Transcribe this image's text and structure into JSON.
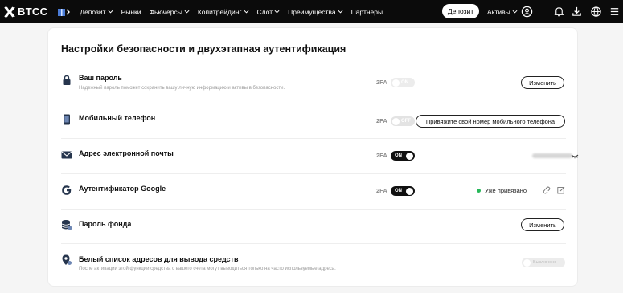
{
  "nav": {
    "logo_text": "BTCC",
    "items": [
      {
        "label": "Депозит",
        "has_caret": true
      },
      {
        "label": "Рынки",
        "has_caret": false
      },
      {
        "label": "Фьючерсы",
        "has_caret": true
      },
      {
        "label": "Копитрейдинг",
        "has_caret": true
      },
      {
        "label": "Слот",
        "has_caret": true
      },
      {
        "label": "Преимущества",
        "has_caret": true
      },
      {
        "label": "Партнеры",
        "has_caret": false
      }
    ],
    "deposit_button": "Депозит",
    "assets_label": "Активы",
    "icons": [
      "user-icon",
      "bell-icon",
      "download-icon",
      "globe-icon",
      "menu-icon"
    ]
  },
  "page": {
    "title": "Настройки безопасности и двухэтапная аутентификация"
  },
  "rows": [
    {
      "title": "Ваш пароль",
      "desc": "Надежный пароль поможет сохранить вашу личную информацию и активы в безопасности.",
      "twofa": "2FA",
      "toggle": {
        "state": "off",
        "label": "ON"
      },
      "action": "Изменить",
      "icon": "lock-icon"
    },
    {
      "title": "Мобильный телефон",
      "twofa": "2FA",
      "toggle": {
        "state": "off",
        "label": "OFF"
      },
      "action": "Привяжите свой номер мобильного телефона",
      "icon": "phone-icon"
    },
    {
      "title": "Адрес электронной почты",
      "twofa": "2FA",
      "toggle": {
        "state": "on",
        "label": "ON"
      },
      "icon": "mail-icon"
    },
    {
      "title": "Аутентификатор Google",
      "twofa": "2FA",
      "toggle": {
        "state": "on",
        "label": "ON"
      },
      "status": "Уже привязано",
      "icon": "google-icon"
    },
    {
      "title": "Пароль фонда",
      "action": "Изменить",
      "icon": "database-icon"
    },
    {
      "title": "Белый список адресов для вывода средств",
      "desc": "После активации этой функции средства с вашего счета могут выводиться только на часто используемые адреса.",
      "toggle": {
        "state": "disabled",
        "label": "Выключено"
      },
      "icon": "location-pin-icon"
    }
  ],
  "colors": {
    "nav_bg": "#0b0b0b",
    "toggle_on": "#111111",
    "status_green": "#27b85a"
  }
}
